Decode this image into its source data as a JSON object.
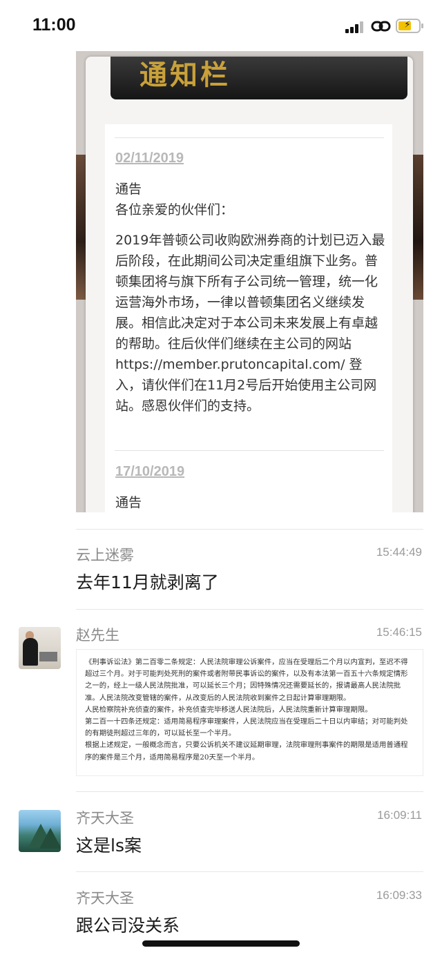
{
  "status_bar": {
    "time": "11:00"
  },
  "shared_image": {
    "banner_title": "通知栏",
    "notices": [
      {
        "date": "02/11/2019",
        "heading": "通告",
        "greeting": "各位亲爱的伙伴们：",
        "body": "2019年普顿公司收购欧洲券商的计划已迈入最后阶段，在此期间公司决定重组旗下业务。普顿集团将与旗下所有子公司统一管理，统一化运营海外市场，一律以普顿集团名义继续发展。相信此决定对于本公司未来发展上有卓越的帮助。往后伙伴们继续在主公司的网站",
        "url_line": "https://member.prutoncapital.com/ 登",
        "tail": "入，请伙伴们在11月2号后开始使用主公司网站。感恩伙伴们的支持。"
      },
      {
        "date": "17/10/2019",
        "heading": "通告"
      }
    ]
  },
  "messages": [
    {
      "sender": "云上迷雾",
      "time": "15:44:49",
      "text": "去年11月就剥离了"
    },
    {
      "sender": "赵先生",
      "time": "15:46:15",
      "image_text_lines": [
        "《刑事诉讼法》第二百零二条规定：人民法院审理公诉案件，应当在受理后二个月以内宣判，至迟不得",
        "超过三个月。对于可能判处死刑的案件或者附带民事诉讼的案件，以及有本法第一百五十六条规定情形",
        "之一的，经上一级人民法院批准，可以延长三个月；因特殊情况还需要延长的，报请最高人民法院批",
        "准。人民法院改变管辖的案件，从改变后的人民法院收到案件之日起计算审理期限。",
        "人民检察院补充侦查的案件，补充侦查完毕移送人民法院后，人民法院重新计算审理期限。",
        "第二百一十四条还规定：适用简易程序审理案件，人民法院应当在受理后二十日以内审结；对可能判处",
        "的有期徒刑超过三年的，可以延长至一个半月。",
        "根据上述规定，一般概念而言，只要公诉机关不建议延期审理，法院审理刑事案件的期限是适用普通程",
        "序的案件是三个月，适用简易程序是20天至一个半月。"
      ]
    },
    {
      "sender": "齐天大圣",
      "time": "16:09:11",
      "text": "这是ls案"
    },
    {
      "sender": "齐天大圣",
      "time": "16:09:33",
      "text": "跟公司没关系"
    }
  ]
}
